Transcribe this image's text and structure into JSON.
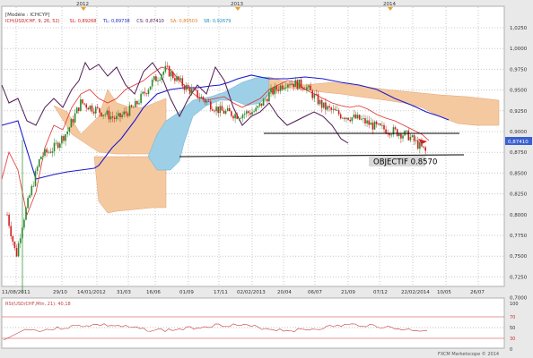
{
  "main_chart": {
    "model_label": "[Modèle : ICHCYP]",
    "legend": [
      {
        "text": "ICH(USD/CHF, 9, 26, 52)",
        "color": "#cc2020"
      },
      {
        "text": "SL: 0,89268",
        "color": "#cc2020"
      },
      {
        "text": "TL: 0,89738",
        "color": "#2030c0"
      },
      {
        "text": "CS: 0,87410",
        "color": "#502050"
      },
      {
        "text": "SA: 0,89503",
        "color": "#e08030"
      },
      {
        "text": "SB: 0,92679",
        "color": "#2090c0"
      }
    ],
    "year_labels": [
      "2012",
      "2013",
      "2014"
    ],
    "price_axis": [
      "1,0250",
      "1,0000",
      "0,9750",
      "0,9500",
      "0,9250",
      "0,9000",
      "0,8750",
      "0,8500",
      "0,8250",
      "0,8000",
      "0,7750",
      "0,7500",
      "0,7250",
      "0,7000"
    ],
    "price_tag": "0,87410",
    "date_axis": [
      "11/08/2011",
      "29/10",
      "14/01/2012",
      "31/03",
      "16/06",
      "01/09",
      "17/11",
      "02/02/2013",
      "20/04",
      "06/07",
      "21/09",
      "07/12",
      "22/02/2014",
      "10/05",
      "26/07"
    ],
    "annotation": "OBJECTIF  0.8570"
  },
  "oscillator": {
    "legend": "RSI(USD/CHF,Mtn, 21): 40,18",
    "axis": [
      "100",
      "70",
      "50",
      "30",
      "0"
    ]
  },
  "footer": "FXCM Marketscope © 2014",
  "colors": {
    "kijun": "#1a1acc",
    "tenkan": "#e03030",
    "chikou": "#501a55",
    "cloud_bull": "#9dd0e6",
    "cloud_bear": "#f5c9a0",
    "candle_up": "#2a8a2a",
    "candle_down": "#d02020"
  },
  "chart_data": {
    "type": "candlestick",
    "instrument": "USD/CHF",
    "ylim": [
      0.7,
      1.04
    ],
    "x": [
      "11/08/2011",
      "29/10",
      "14/01/2012",
      "31/03",
      "16/06",
      "01/09",
      "17/11",
      "02/02/2013",
      "20/04",
      "06/07",
      "21/09",
      "07/12",
      "22/02/2014"
    ],
    "close": [
      0.8,
      0.88,
      0.905,
      0.915,
      0.95,
      0.96,
      0.915,
      0.93,
      0.965,
      0.94,
      0.915,
      0.89,
      0.874
    ],
    "objective": 0.857
  }
}
